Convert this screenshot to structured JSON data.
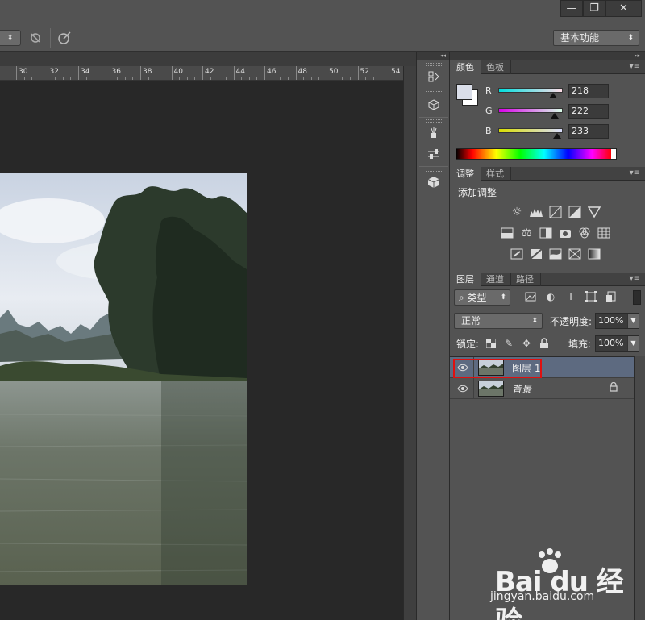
{
  "window": {
    "minimize": "—",
    "restore": "❐",
    "close": "✕"
  },
  "toolbar": {
    "workspace": "基本功能"
  },
  "ruler": {
    "ticks": [
      "30",
      "32",
      "34",
      "36",
      "38",
      "40",
      "42",
      "44",
      "46",
      "48",
      "50",
      "52",
      "54"
    ]
  },
  "panels": {
    "color_tabs": [
      "颜色",
      "色板"
    ],
    "color": {
      "r_label": "R",
      "g_label": "G",
      "b_label": "B",
      "r": "218",
      "g": "222",
      "b": "233",
      "r_fill": 0.855,
      "g_fill": 0.871,
      "b_fill": 0.914,
      "foreground": "#dadee9",
      "background": "#ffffff"
    },
    "adjust_tabs": [
      "调整",
      "样式"
    ],
    "adjust_title": "添加调整",
    "layer_tabs": [
      "图层",
      "通道",
      "路径"
    ],
    "layers": {
      "filter": "类型",
      "blend": "正常",
      "opacity_label": "不透明度:",
      "opacity": "100%",
      "lock_label": "锁定:",
      "fill_label": "填充:",
      "fill": "100%",
      "items": [
        {
          "name": "图层 1",
          "selected": true
        },
        {
          "name": "背景",
          "selected": false,
          "locked": true
        }
      ]
    }
  },
  "watermark": {
    "brand": "Bai du 经验",
    "url": "jingyan.baidu.com"
  }
}
